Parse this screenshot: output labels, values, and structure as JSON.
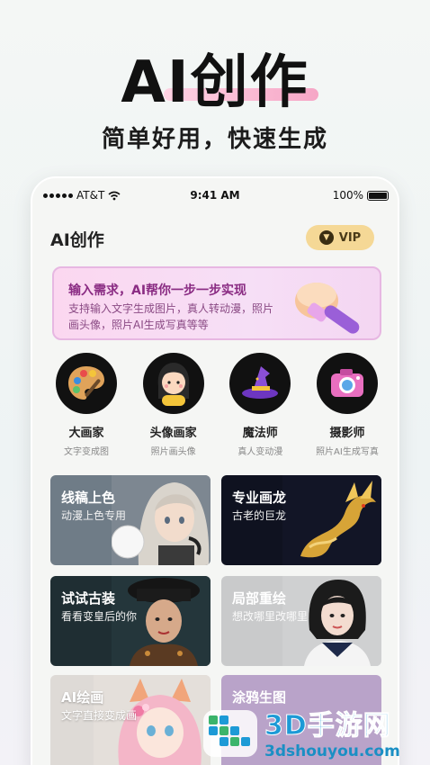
{
  "hero": {
    "title": "AI创作",
    "subtitle": "简单好用，快速生成"
  },
  "status_bar": {
    "carrier": "AT&T",
    "time": "9:41 AM",
    "battery": "100%"
  },
  "app": {
    "title": "AI创作",
    "vip_label": "VIP"
  },
  "banner": {
    "title": "输入需求，AI帮你一步一步实现",
    "description": "支持输入文字生成图片，真人转动漫，照片画头像，照片AI生成写真等等"
  },
  "features": [
    {
      "name": "大画家",
      "sub": "文字变成图",
      "icon": "palette-icon"
    },
    {
      "name": "头像画家",
      "sub": "照片画头像",
      "icon": "avatar-girl-icon"
    },
    {
      "name": "魔法师",
      "sub": "真人变动漫",
      "icon": "wizard-hat-icon"
    },
    {
      "name": "摄影师",
      "sub": "照片AI生成写真",
      "icon": "camera-icon"
    }
  ],
  "cards": [
    {
      "title": "线稿上色",
      "sub": "动漫上色专用"
    },
    {
      "title": "专业画龙",
      "sub": "古老的巨龙"
    },
    {
      "title": "试试古装",
      "sub": "看看变皇后的你"
    },
    {
      "title": "局部重绘",
      "sub": "想改哪里改哪里"
    },
    {
      "title": "AI绘画",
      "sub": "文字直接变成画"
    },
    {
      "title": "涂鸦生图",
      "sub": ""
    }
  ],
  "watermark": {
    "name": "3D手游网",
    "url": "3dshouyou.com"
  },
  "colors": {
    "banner_text": "#8a2c83",
    "vip_bg": "#f5d896",
    "watermark": "#1d9ad6"
  }
}
